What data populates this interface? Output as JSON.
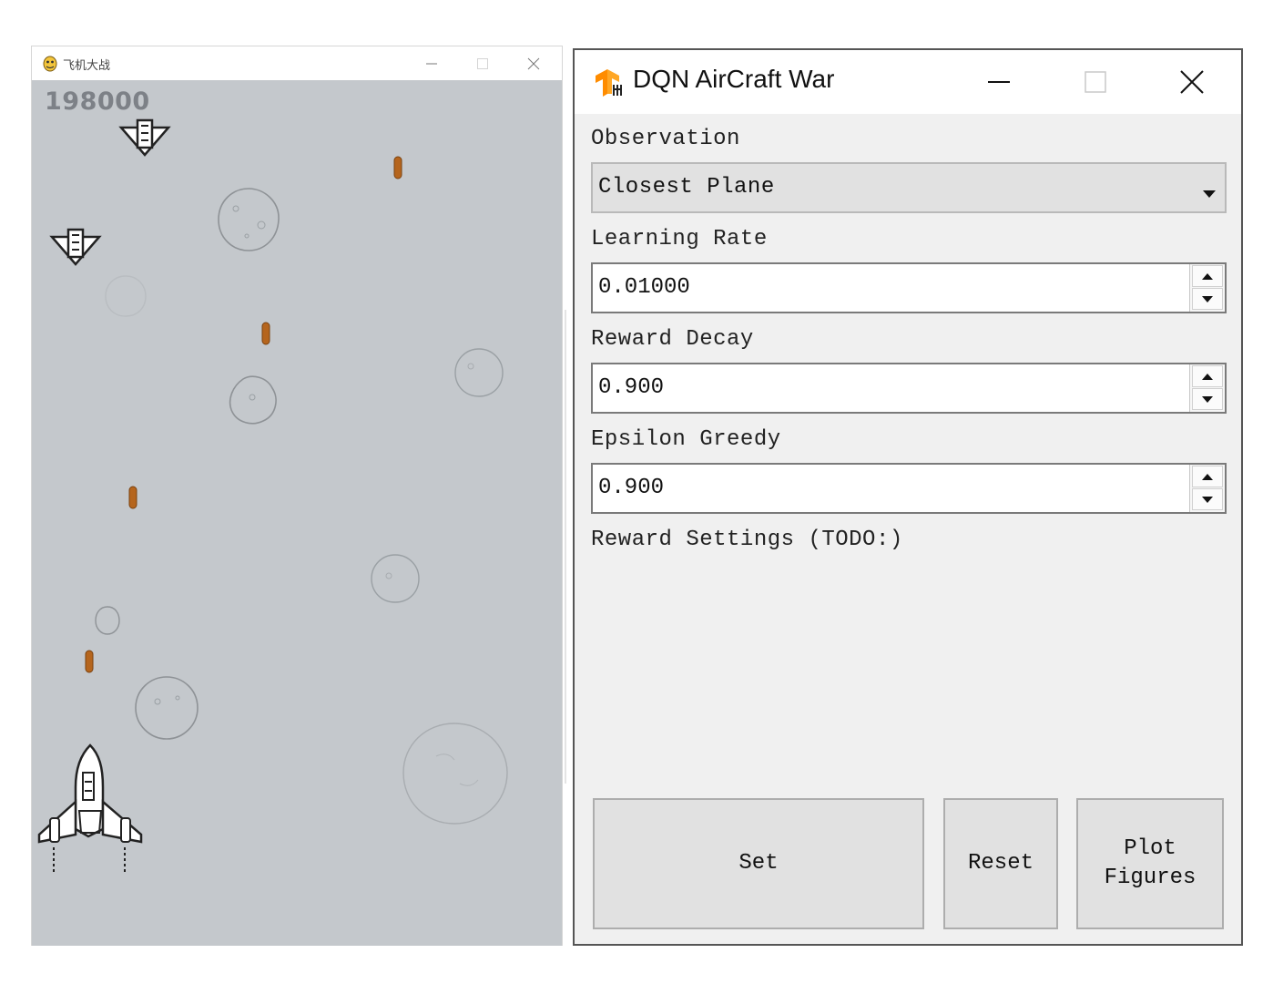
{
  "game_window": {
    "title": "飞机大战",
    "score": "198000",
    "icons": [
      "pygame-logo-icon",
      "minimize-icon",
      "maximize-icon",
      "close-icon"
    ],
    "colors": {
      "background": "#c4c8cc",
      "score": "#7d8187",
      "bullet": "#b5651d"
    }
  },
  "control_window": {
    "title": "DQN AirCraft War",
    "icons": [
      "tensorflow-logo-icon",
      "minimize-icon",
      "maximize-icon",
      "close-icon"
    ],
    "observation": {
      "label": "Observation",
      "value": "Closest Plane"
    },
    "learning_rate": {
      "label": "Learning Rate",
      "value": "0.01000"
    },
    "reward_decay": {
      "label": "Reward Decay",
      "value": "0.900"
    },
    "epsilon_greedy": {
      "label": "Epsilon Greedy",
      "value": "0.900"
    },
    "reward_settings": {
      "label": "Reward Settings (TODO:)"
    },
    "buttons": {
      "set": "Set",
      "reset": "Reset",
      "plot": "Plot Figures"
    },
    "colors": {
      "accent": "#ff8c00",
      "window_bg": "#f0f0f0",
      "button_bg": "#e1e1e1"
    }
  }
}
